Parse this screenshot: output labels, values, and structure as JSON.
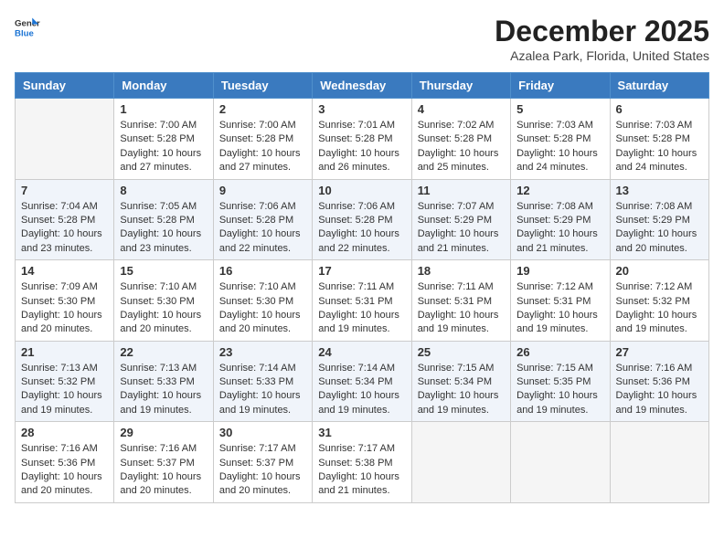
{
  "header": {
    "logo_line1": "General",
    "logo_line2": "Blue",
    "title": "December 2025",
    "subtitle": "Azalea Park, Florida, United States"
  },
  "calendar": {
    "days_of_week": [
      "Sunday",
      "Monday",
      "Tuesday",
      "Wednesday",
      "Thursday",
      "Friday",
      "Saturday"
    ],
    "weeks": [
      [
        {
          "day": "",
          "info": ""
        },
        {
          "day": "1",
          "info": "Sunrise: 7:00 AM\nSunset: 5:28 PM\nDaylight: 10 hours\nand 27 minutes."
        },
        {
          "day": "2",
          "info": "Sunrise: 7:00 AM\nSunset: 5:28 PM\nDaylight: 10 hours\nand 27 minutes."
        },
        {
          "day": "3",
          "info": "Sunrise: 7:01 AM\nSunset: 5:28 PM\nDaylight: 10 hours\nand 26 minutes."
        },
        {
          "day": "4",
          "info": "Sunrise: 7:02 AM\nSunset: 5:28 PM\nDaylight: 10 hours\nand 25 minutes."
        },
        {
          "day": "5",
          "info": "Sunrise: 7:03 AM\nSunset: 5:28 PM\nDaylight: 10 hours\nand 24 minutes."
        },
        {
          "day": "6",
          "info": "Sunrise: 7:03 AM\nSunset: 5:28 PM\nDaylight: 10 hours\nand 24 minutes."
        }
      ],
      [
        {
          "day": "7",
          "info": "Sunrise: 7:04 AM\nSunset: 5:28 PM\nDaylight: 10 hours\nand 23 minutes."
        },
        {
          "day": "8",
          "info": "Sunrise: 7:05 AM\nSunset: 5:28 PM\nDaylight: 10 hours\nand 23 minutes."
        },
        {
          "day": "9",
          "info": "Sunrise: 7:06 AM\nSunset: 5:28 PM\nDaylight: 10 hours\nand 22 minutes."
        },
        {
          "day": "10",
          "info": "Sunrise: 7:06 AM\nSunset: 5:28 PM\nDaylight: 10 hours\nand 22 minutes."
        },
        {
          "day": "11",
          "info": "Sunrise: 7:07 AM\nSunset: 5:29 PM\nDaylight: 10 hours\nand 21 minutes."
        },
        {
          "day": "12",
          "info": "Sunrise: 7:08 AM\nSunset: 5:29 PM\nDaylight: 10 hours\nand 21 minutes."
        },
        {
          "day": "13",
          "info": "Sunrise: 7:08 AM\nSunset: 5:29 PM\nDaylight: 10 hours\nand 20 minutes."
        }
      ],
      [
        {
          "day": "14",
          "info": "Sunrise: 7:09 AM\nSunset: 5:30 PM\nDaylight: 10 hours\nand 20 minutes."
        },
        {
          "day": "15",
          "info": "Sunrise: 7:10 AM\nSunset: 5:30 PM\nDaylight: 10 hours\nand 20 minutes."
        },
        {
          "day": "16",
          "info": "Sunrise: 7:10 AM\nSunset: 5:30 PM\nDaylight: 10 hours\nand 20 minutes."
        },
        {
          "day": "17",
          "info": "Sunrise: 7:11 AM\nSunset: 5:31 PM\nDaylight: 10 hours\nand 19 minutes."
        },
        {
          "day": "18",
          "info": "Sunrise: 7:11 AM\nSunset: 5:31 PM\nDaylight: 10 hours\nand 19 minutes."
        },
        {
          "day": "19",
          "info": "Sunrise: 7:12 AM\nSunset: 5:31 PM\nDaylight: 10 hours\nand 19 minutes."
        },
        {
          "day": "20",
          "info": "Sunrise: 7:12 AM\nSunset: 5:32 PM\nDaylight: 10 hours\nand 19 minutes."
        }
      ],
      [
        {
          "day": "21",
          "info": "Sunrise: 7:13 AM\nSunset: 5:32 PM\nDaylight: 10 hours\nand 19 minutes."
        },
        {
          "day": "22",
          "info": "Sunrise: 7:13 AM\nSunset: 5:33 PM\nDaylight: 10 hours\nand 19 minutes."
        },
        {
          "day": "23",
          "info": "Sunrise: 7:14 AM\nSunset: 5:33 PM\nDaylight: 10 hours\nand 19 minutes."
        },
        {
          "day": "24",
          "info": "Sunrise: 7:14 AM\nSunset: 5:34 PM\nDaylight: 10 hours\nand 19 minutes."
        },
        {
          "day": "25",
          "info": "Sunrise: 7:15 AM\nSunset: 5:34 PM\nDaylight: 10 hours\nand 19 minutes."
        },
        {
          "day": "26",
          "info": "Sunrise: 7:15 AM\nSunset: 5:35 PM\nDaylight: 10 hours\nand 19 minutes."
        },
        {
          "day": "27",
          "info": "Sunrise: 7:16 AM\nSunset: 5:36 PM\nDaylight: 10 hours\nand 19 minutes."
        }
      ],
      [
        {
          "day": "28",
          "info": "Sunrise: 7:16 AM\nSunset: 5:36 PM\nDaylight: 10 hours\nand 20 minutes."
        },
        {
          "day": "29",
          "info": "Sunrise: 7:16 AM\nSunset: 5:37 PM\nDaylight: 10 hours\nand 20 minutes."
        },
        {
          "day": "30",
          "info": "Sunrise: 7:17 AM\nSunset: 5:37 PM\nDaylight: 10 hours\nand 20 minutes."
        },
        {
          "day": "31",
          "info": "Sunrise: 7:17 AM\nSunset: 5:38 PM\nDaylight: 10 hours\nand 21 minutes."
        },
        {
          "day": "",
          "info": ""
        },
        {
          "day": "",
          "info": ""
        },
        {
          "day": "",
          "info": ""
        }
      ]
    ]
  }
}
